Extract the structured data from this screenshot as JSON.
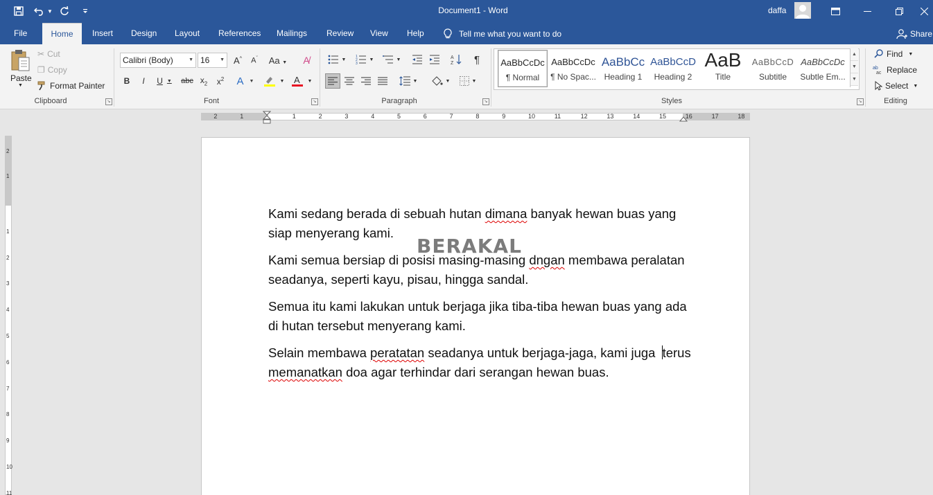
{
  "titlebar": {
    "doc_title": "Document1  -  Word",
    "user": "daffa"
  },
  "tabs": [
    "File",
    "Home",
    "Insert",
    "Design",
    "Layout",
    "References",
    "Mailings",
    "Review",
    "View",
    "Help"
  ],
  "active_tab": "Home",
  "tell_me": "Tell me what you want to do",
  "share": "Share",
  "clipboard": {
    "paste": "Paste",
    "cut": "Cut",
    "copy": "Copy",
    "format_painter": "Format Painter",
    "label": "Clipboard"
  },
  "font": {
    "name": "Calibri (Body)",
    "size": "16",
    "label": "Font"
  },
  "paragraph": {
    "label": "Paragraph"
  },
  "styles": {
    "label": "Styles",
    "items": [
      {
        "preview": "AaBbCcDc",
        "name": "¶ Normal"
      },
      {
        "preview": "AaBbCcDc",
        "name": "¶ No Spac..."
      },
      {
        "preview": "AaBbCc",
        "name": "Heading 1"
      },
      {
        "preview": "AaBbCcD",
        "name": "Heading 2"
      },
      {
        "preview": "AaB",
        "name": "Title"
      },
      {
        "preview": "AaBbCcD",
        "name": "Subtitle"
      },
      {
        "preview": "AaBbCcDc",
        "name": "Subtle Em..."
      }
    ]
  },
  "editing": {
    "find": "Find",
    "replace": "Replace",
    "select": "Select",
    "label": "Editing"
  },
  "ruler": {
    "numbers": [
      "2",
      "1",
      "1",
      "2",
      "3",
      "4",
      "5",
      "6",
      "7",
      "8",
      "9",
      "10",
      "11",
      "12",
      "13",
      "14",
      "15",
      "16",
      "17",
      "18"
    ],
    "v_numbers": [
      "2",
      "1",
      "1",
      "2",
      "3",
      "4",
      "5",
      "6",
      "7",
      "8",
      "9",
      "10",
      "11"
    ]
  },
  "document": {
    "watermark": "BERAKAL",
    "paragraphs": [
      [
        "Kami sedang berada di sebuah hutan ",
        {
          "sq": "dimana"
        },
        " banyak hewan buas yang siap menyerang kami."
      ],
      [
        "Kami semua bersiap di posisi masing-masing ",
        {
          "sq": "dngan"
        },
        " membawa peralatan seadanya, seperti kayu, pisau, hingga sandal."
      ],
      [
        "Semua itu kami lakukan untuk berjaga jika tiba-tiba hewan buas yang ada di hutan tersebut menyerang kami."
      ],
      [
        "Selain membawa ",
        {
          "sq": "peratatan"
        },
        " seadanya untuk berjaga-jaga, kami juga ",
        {
          "caret": true
        },
        "terus ",
        {
          "sq": "memanatkan"
        },
        " doa agar terhindar dari serangan hewan buas."
      ]
    ]
  },
  "colors": {
    "word_blue": "#2b579a",
    "ribbon": "#f3f3f3",
    "highlight": "#ffff00",
    "font_color": "#e81123"
  }
}
